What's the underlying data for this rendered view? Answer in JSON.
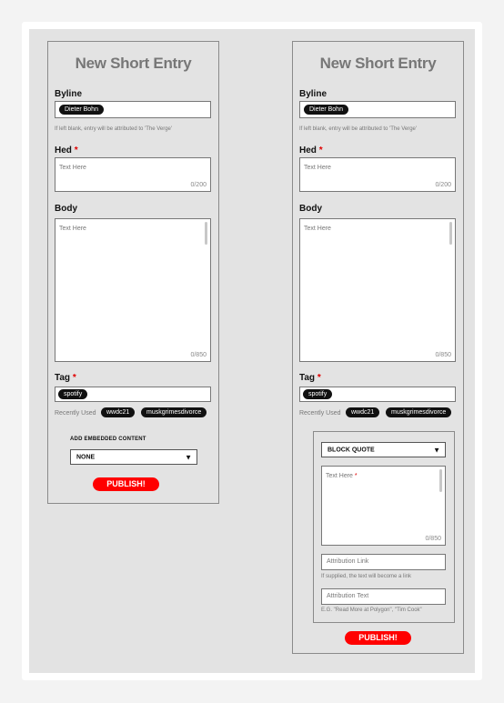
{
  "left": {
    "title": "New Short Entry",
    "byline_label": "Byline",
    "byline_chip": "Dieter Bohn",
    "byline_help": "If left blank, entry will be attributed to 'The Verge'",
    "hed_label": "Hed",
    "required_mark": "*",
    "hed_placeholder": "Text Here",
    "hed_counter": "0/200",
    "body_label": "Body",
    "body_placeholder": "Text Here",
    "body_counter": "0/850",
    "tag_label": "Tag",
    "tag_chip": "spotify",
    "recently_used_label": "Recently Used",
    "recent_tags": [
      "wwdc21",
      "muskgrimesdivorce"
    ],
    "embed_label": "ADD EMBEDDED CONTENT",
    "embed_value": "NONE",
    "publish_label": "PUBLISH!"
  },
  "right": {
    "title": "New Short Entry",
    "byline_label": "Byline",
    "byline_chip": "Dieter Bohn",
    "byline_help": "If left blank, entry will be attributed to 'The Verge'",
    "hed_label": "Hed",
    "required_mark": "*",
    "hed_placeholder": "Text Here",
    "hed_counter": "0/200",
    "body_label": "Body",
    "body_placeholder": "Text Here",
    "body_counter": "0/850",
    "tag_label": "Tag",
    "tag_chip": "spotify",
    "recently_used_label": "Recently Used",
    "recent_tags": [
      "wwdc21",
      "muskgrimesdivorce"
    ],
    "embed_value": "BLOCK QUOTE",
    "quote_placeholder": "Text Here",
    "quote_counter": "0/850",
    "attribution_link_placeholder": "Attribution Link",
    "attribution_link_help": "If supplied, the text will become a link",
    "attribution_text_placeholder": "Attribution Text",
    "attribution_text_help": "E.G. \"Read More at Polygon\", \"Tim Cook\"",
    "publish_label": "PUBLISH!"
  },
  "colors": {
    "accent": "#ff0000",
    "chip": "#111111",
    "canvas": "#e3e3e3"
  }
}
